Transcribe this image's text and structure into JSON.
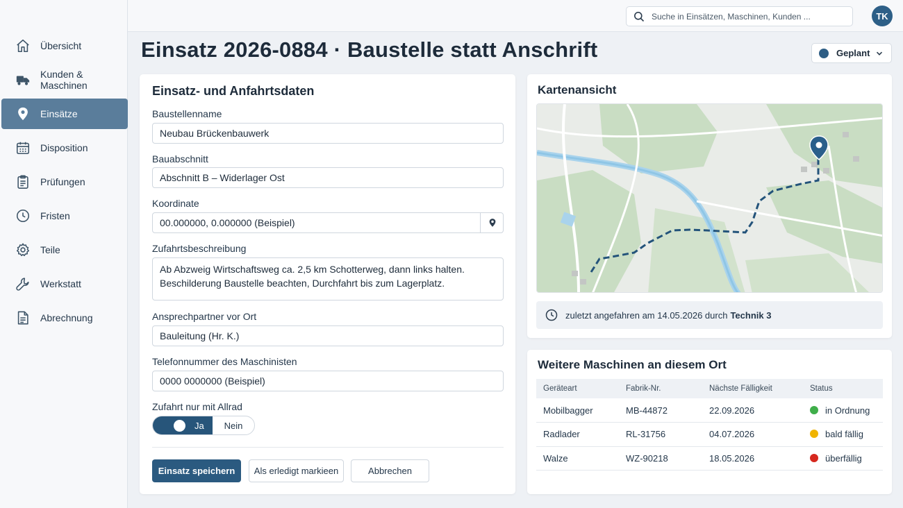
{
  "app": {
    "search_placeholder": "Suche in Einsätzen, Maschinen, Kunden ...",
    "user_initials": "TK"
  },
  "sidebar": {
    "items": [
      {
        "label": "Übersicht",
        "icon": "home-icon"
      },
      {
        "label": "Kunden & Maschinen",
        "icon": "truck-icon"
      },
      {
        "label": "Einsätze",
        "icon": "map-pin-icon",
        "active": true
      },
      {
        "label": "Disposition",
        "icon": "calendar-icon"
      },
      {
        "label": "Prüfungen",
        "icon": "clipboard-icon"
      },
      {
        "label": "Fristen",
        "icon": "clock-icon"
      },
      {
        "label": "Teile",
        "icon": "gear-icon"
      },
      {
        "label": "Werkstatt",
        "icon": "wrench-icon"
      },
      {
        "label": "Abrechnung",
        "icon": "document-icon"
      }
    ]
  },
  "page": {
    "title": "Einsatz 2026-0884 · Baustelle statt Anschrift",
    "status": {
      "label": "Geplant",
      "color": "#2e5e85"
    }
  },
  "form": {
    "title": "Einsatz- und Anfahrtsdaten",
    "site_name": {
      "label": "Baustellenname",
      "value": "Neubau Brückenbauwerk"
    },
    "section": {
      "label": "Bauabschnitt",
      "value": "Abschnitt B – Widerlager Ost"
    },
    "coordinate": {
      "label": "Koordinate",
      "value": "00.000000, 0.000000 (Beispiel)"
    },
    "access": {
      "label": "Zufahrtsbeschreibung",
      "value": "Ab Abzweig Wirtschaftsweg ca. 2,5 km Schotterweg, dann links halten.\nBeschilderung Baustelle beachten, Durchfahrt bis zum Lagerplatz."
    },
    "contact": {
      "label": "Ansprechpartner vor Ort",
      "value": "Bauleitung (Hr. K.)"
    },
    "phone": {
      "label": "Telefonnummer des Maschinisten",
      "value": "0000 0000000 (Beispiel)"
    },
    "allrad": {
      "label": "Zufahrt nur mit Allrad",
      "yes": "Ja",
      "no": "Nein",
      "selected": "Ja"
    },
    "buttons": {
      "save": "Einsatz speichern",
      "done": "Als erledigt markieen",
      "cancel": "Abbrechen"
    }
  },
  "map": {
    "title": "Kartenansicht",
    "last_visit_text": "zuletzt angefahren am 14.05.2026 durch",
    "last_visit_by": "Technik 3"
  },
  "machines": {
    "title": "Weitere Maschinen an diesem Ort",
    "headers": [
      "Geräteart",
      "Fabrik-Nr.",
      "Nächste Fälligkeit",
      "Status"
    ],
    "rows": [
      {
        "type": "Mobilbagger",
        "serial": "MB-44872",
        "due": "22.09.2026",
        "status": "in Ordnung",
        "color": "#3fae4a"
      },
      {
        "type": "Radlader",
        "serial": "RL-31756",
        "due": "04.07.2026",
        "status": "bald fällig",
        "color": "#f0b400"
      },
      {
        "type": "Walze",
        "serial": "WZ-90218",
        "due": "18.05.2026",
        "status": "überfällig",
        "color": "#d6281e"
      }
    ]
  }
}
